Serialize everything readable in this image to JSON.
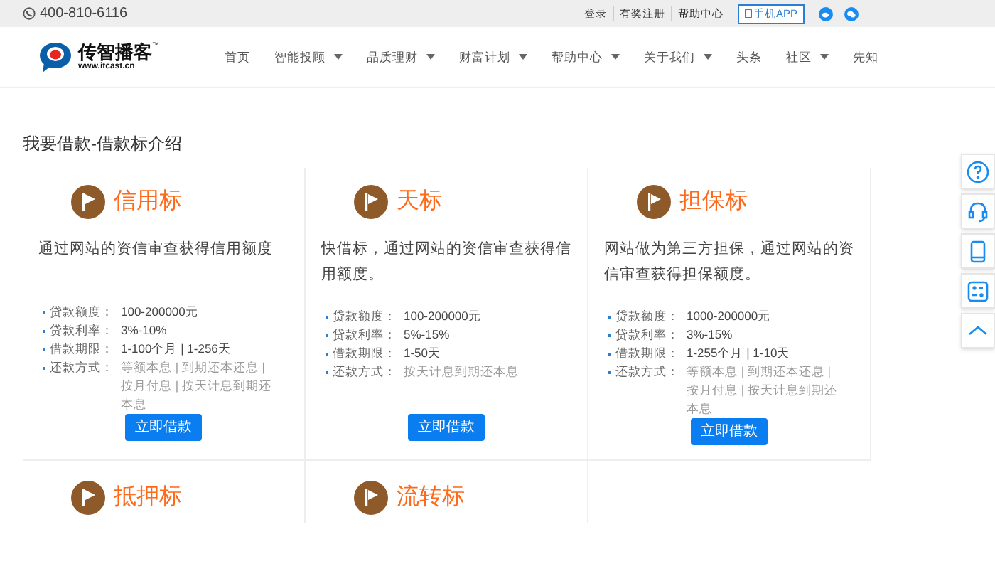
{
  "top_bar": {
    "phone": "400-810-6116",
    "links": [
      "登录",
      "有奖注册",
      "帮助中心"
    ],
    "app_button": "手机APP"
  },
  "header": {
    "logo_name": "传智播客",
    "logo_sub": "www.itcast.cn",
    "logo_mark": "™",
    "nav": [
      {
        "label": "首页",
        "dropdown": false
      },
      {
        "label": "智能投顾",
        "dropdown": true
      },
      {
        "label": "品质理财",
        "dropdown": true
      },
      {
        "label": "财富计划",
        "dropdown": true
      },
      {
        "label": "帮助中心",
        "dropdown": true
      },
      {
        "label": "关于我们",
        "dropdown": true
      },
      {
        "label": "头条",
        "dropdown": false
      },
      {
        "label": "社区",
        "dropdown": true
      },
      {
        "label": "先知",
        "dropdown": false
      }
    ]
  },
  "page_title": "我要借款-借款标介绍",
  "cards": [
    {
      "title": "信用标",
      "description": "通过网站的资信审查获得信用额度",
      "details": [
        {
          "label": "贷款额度：",
          "value": "100-200000元",
          "muted": false
        },
        {
          "label": "贷款利率：",
          "value": "3%-10%",
          "muted": false
        },
        {
          "label": "借款期限：",
          "value": "1-100个月 | 1-256天",
          "muted": false
        },
        {
          "label": "还款方式：",
          "value": "等额本息 | 到期还本还息 | 按月付息 | 按天计息到期还本息",
          "muted": true
        }
      ],
      "button": "立即借款"
    },
    {
      "title": "天标",
      "description": "快借标，通过网站的资信审查获得信用额度。",
      "details": [
        {
          "label": "贷款额度：",
          "value": "100-200000元",
          "muted": false
        },
        {
          "label": "贷款利率：",
          "value": "5%-15%",
          "muted": false
        },
        {
          "label": "借款期限：",
          "value": "1-50天",
          "muted": false
        },
        {
          "label": "还款方式：",
          "value": "按天计息到期还本息",
          "muted": true
        }
      ],
      "button": "立即借款"
    },
    {
      "title": "担保标",
      "description": "网站做为第三方担保，通过网站的资信审查获得担保额度。",
      "details": [
        {
          "label": "贷款额度：",
          "value": "1000-200000元",
          "muted": false
        },
        {
          "label": "贷款利率：",
          "value": "3%-15%",
          "muted": false
        },
        {
          "label": "借款期限：",
          "value": "1-255个月 | 1-10天",
          "muted": false
        },
        {
          "label": "还款方式：",
          "value": "等额本息 | 到期还本还息 | 按月付息 | 按天计息到期还本息",
          "muted": true
        }
      ],
      "button": "立即借款"
    },
    {
      "title": "抵押标"
    },
    {
      "title": "流转标"
    }
  ]
}
